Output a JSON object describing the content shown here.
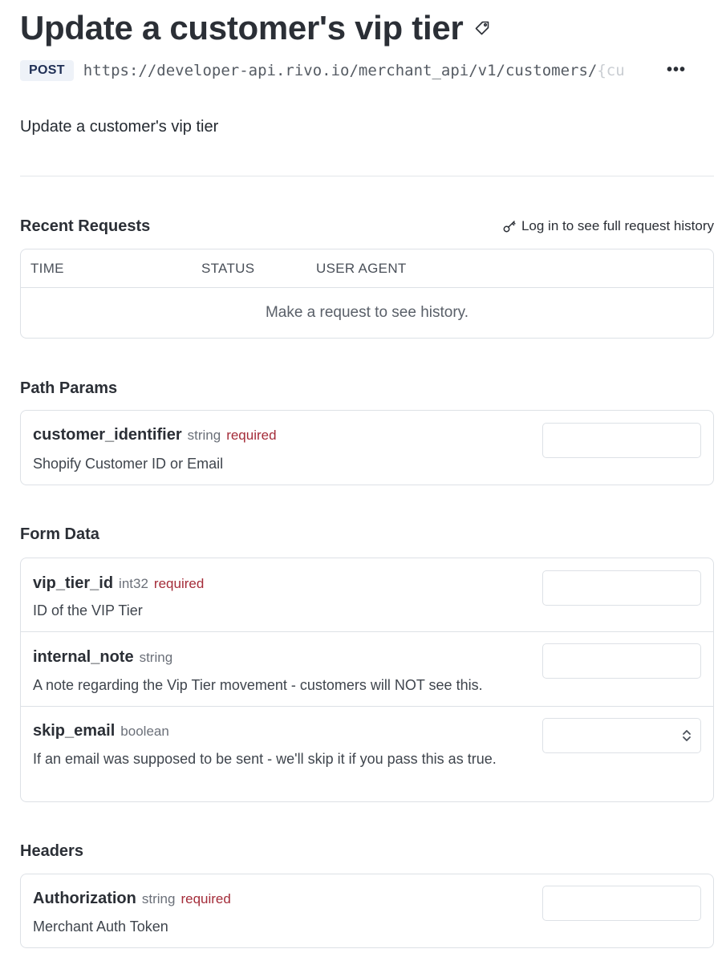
{
  "header": {
    "title": "Update a customer's vip tier",
    "method": "POST",
    "url_visible": "https://developer-api.rivo.io/merchant_api/v1/customers/",
    "url_faded": "{cu",
    "more": "•••"
  },
  "description": "Update a customer's vip tier",
  "recent_requests": {
    "title": "Recent Requests",
    "login_link": "Log in to see full request history",
    "columns": [
      "TIME",
      "STATUS",
      "USER AGENT"
    ],
    "empty_message": "Make a request to see history."
  },
  "path_params": {
    "title": "Path Params",
    "items": [
      {
        "name": "customer_identifier",
        "type": "string",
        "required": "required",
        "description": "Shopify Customer ID or Email"
      }
    ]
  },
  "form_data": {
    "title": "Form Data",
    "items": [
      {
        "name": "vip_tier_id",
        "type": "int32",
        "required": "required",
        "description": "ID of the VIP Tier"
      },
      {
        "name": "internal_note",
        "type": "string",
        "required": "",
        "description": "A note regarding the Vip Tier movement - customers will NOT see this."
      },
      {
        "name": "skip_email",
        "type": "boolean",
        "required": "",
        "description": "If an email was supposed to be sent - we'll skip it if you pass this as true."
      }
    ]
  },
  "headers": {
    "title": "Headers",
    "items": [
      {
        "name": "Authorization",
        "type": "string",
        "required": "required",
        "description": "Merchant Auth Token"
      }
    ]
  },
  "icons": {
    "tag": "tag-icon",
    "key": "key-icon",
    "select": "chevron-up-down-icon"
  }
}
